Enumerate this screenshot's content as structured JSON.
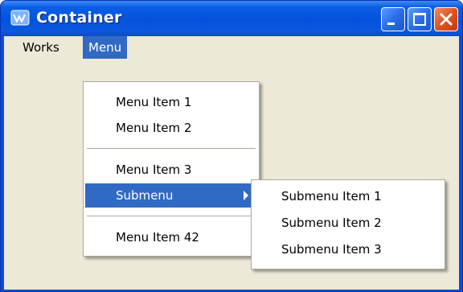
{
  "window": {
    "title": "Container"
  },
  "menubar": {
    "items": [
      "Works",
      "Menu"
    ]
  },
  "menu": {
    "items": [
      "Menu Item 1",
      "Menu Item 2",
      "Menu Item 3",
      "Submenu",
      "Menu Item 42"
    ]
  },
  "submenu": {
    "items": [
      "Submenu Item 1",
      "Submenu Item 2",
      "Submenu Item 3"
    ]
  },
  "colors": {
    "titlebar": "#0552dc",
    "highlight": "#316ac5",
    "menubar_bg": "#ece9d8",
    "close_button": "#e0531f"
  },
  "icons": [
    "app-icon",
    "minimize-icon",
    "maximize-icon",
    "close-icon",
    "submenu-arrow-icon"
  ]
}
